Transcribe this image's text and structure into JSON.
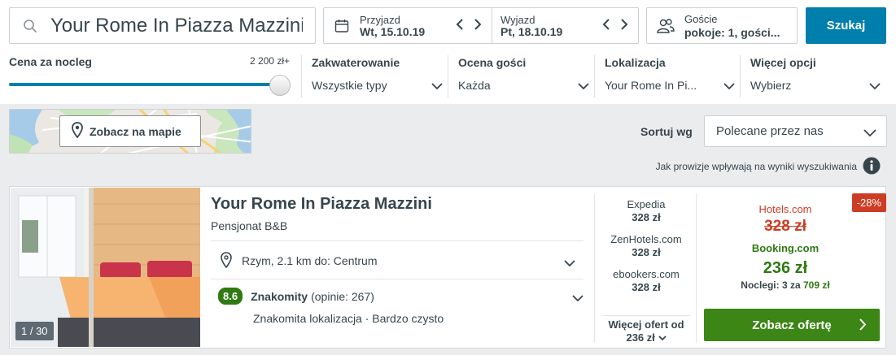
{
  "search": {
    "query": "Your Rome In Piazza Mazzini",
    "checkin_label": "Przyjazd",
    "checkin_value": "Wt, 15.10.19",
    "checkout_label": "Wyjazd",
    "checkout_value": "Pt, 18.10.19",
    "guests_label": "Goście",
    "guests_value": "pokoje: 1, gości...",
    "search_button": "Szukaj"
  },
  "filters": {
    "price_label": "Cena za nocleg",
    "price_max": "2 200 zł+",
    "price_slider_level": 1.0,
    "items": [
      {
        "title": "Zakwaterowanie",
        "value": "Wszystkie typy"
      },
      {
        "title": "Ocena gości",
        "value": "Każda"
      },
      {
        "title": "Lokalizacja",
        "value": "Your Rome In Pi..."
      },
      {
        "title": "Więcej opcji",
        "value": "Wybierz"
      }
    ]
  },
  "map": {
    "button_label": "Zobacz na mapie"
  },
  "sort": {
    "label": "Sortuj wg",
    "selected": "Polecane przez nas",
    "commission_note": "Jak prowizje wpływają na wyniki wyszukiwania"
  },
  "result": {
    "name": "Your Rome In Piazza Mazzini",
    "type": "Pensjonat B&B",
    "photo_counter": "1 / 30",
    "location": "Rzym, 2.1 km do: Centrum",
    "rating_score": "8.6",
    "rating_word": "Znakomity",
    "rating_count": "(opinie: 267)",
    "highlights": "Znakomita lokalizacja · Bardzo czysto",
    "offers": [
      {
        "provider": "Expedia",
        "price": "328 zł"
      },
      {
        "provider": "ZenHotels.com",
        "price": "328 zł"
      },
      {
        "provider": "ebookers.com",
        "price": "328 zł"
      }
    ],
    "more_offers_line1": "Więcej ofert od",
    "more_offers_line2": "236 zł",
    "discount": "-28%",
    "strike_provider": "Hotels.com",
    "strike_price": "328 zł",
    "best_provider": "Booking.com",
    "best_price": "236 zł",
    "nights_text": "Noclegi: 3 za",
    "nights_total": "709 zł",
    "deal_button": "Zobacz ofertę"
  },
  "colors": {
    "primary": "#007fad",
    "deal_green": "#3c8616",
    "discount_red": "#cd3c24"
  }
}
